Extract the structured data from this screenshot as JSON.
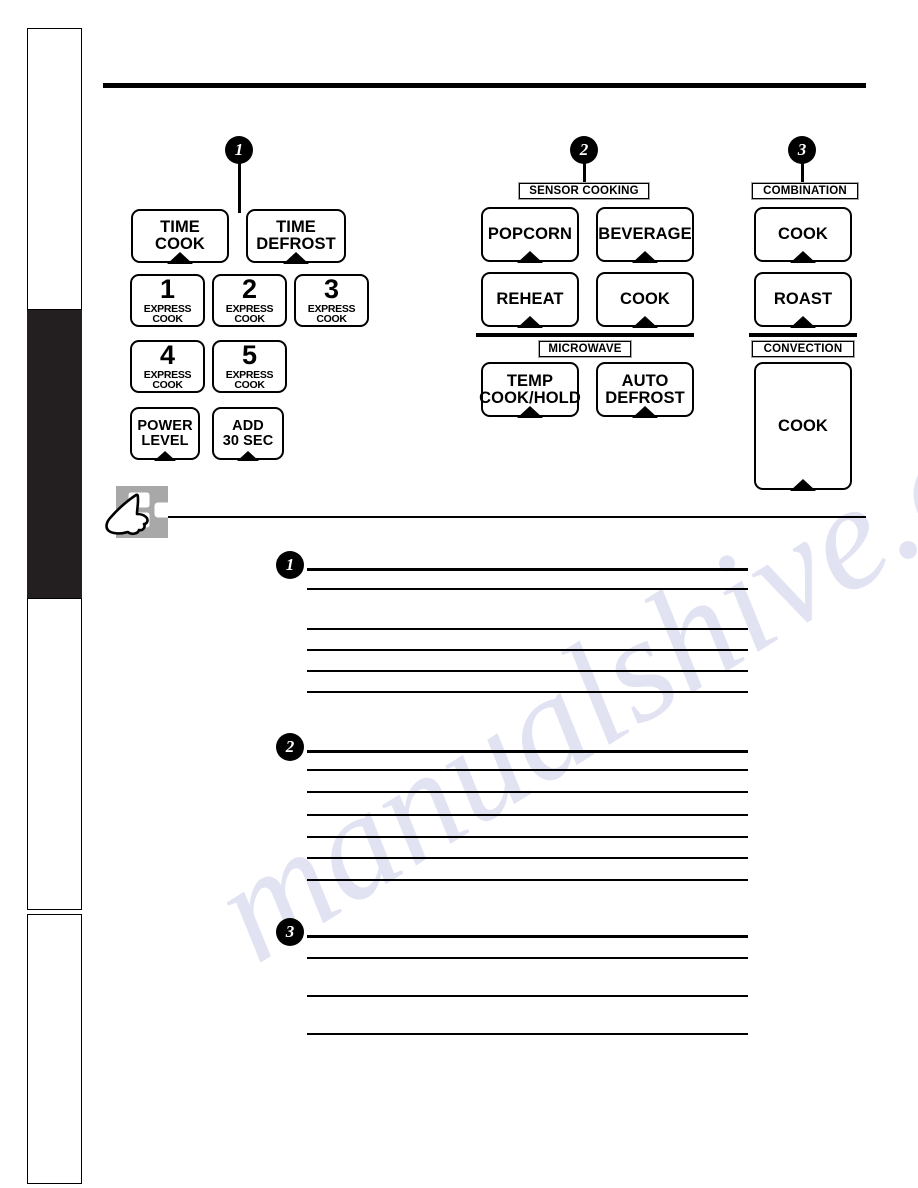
{
  "page": {
    "background": "#ffffff",
    "ink": "#000000",
    "sidebar_active_color": "#231f20",
    "plate_outline_color": "#a6a6a6"
  },
  "sidebar": {
    "tabs": [
      {
        "name": "tab-1",
        "active": false
      },
      {
        "name": "tab-2",
        "active": true
      },
      {
        "name": "tab-3",
        "active": false
      },
      {
        "name": "tab-4",
        "active": false
      }
    ]
  },
  "callouts": [
    {
      "number": "1"
    },
    {
      "number": "2"
    },
    {
      "number": "3"
    }
  ],
  "control_panel": {
    "group1": {
      "callout": "1",
      "keys": [
        {
          "name": "time-cook",
          "lines": [
            "TIME",
            "COOK"
          ],
          "type": "text",
          "notch": true
        },
        {
          "name": "time-defrost",
          "lines": [
            "TIME",
            "DEFROST"
          ],
          "type": "text",
          "notch": true
        },
        {
          "name": "express-cook-1",
          "number": "1",
          "sub": "EXPRESS COOK",
          "type": "express",
          "notch": false
        },
        {
          "name": "express-cook-2",
          "number": "2",
          "sub": "EXPRESS COOK",
          "type": "express",
          "notch": false
        },
        {
          "name": "express-cook-3",
          "number": "3",
          "sub": "EXPRESS COOK",
          "type": "express",
          "notch": false
        },
        {
          "name": "express-cook-4",
          "number": "4",
          "sub": "EXPRESS COOK",
          "type": "express",
          "notch": false
        },
        {
          "name": "express-cook-5",
          "number": "5",
          "sub": "EXPRESS COOK",
          "type": "express",
          "notch": false
        },
        {
          "name": "power-level",
          "lines": [
            "POWER",
            "LEVEL"
          ],
          "type": "text",
          "notch": true
        },
        {
          "name": "add-30-sec",
          "lines": [
            "ADD",
            "30 SEC"
          ],
          "type": "text",
          "notch": true
        }
      ]
    },
    "group2": {
      "callout": "2",
      "caption_sensor": "SENSOR COOKING",
      "caption_microwave": "MICROWAVE",
      "sensor_keys": [
        {
          "name": "popcorn",
          "lines": [
            "POPCORN"
          ],
          "notch": true
        },
        {
          "name": "beverage",
          "lines": [
            "BEVERAGE"
          ],
          "notch": true
        },
        {
          "name": "reheat",
          "lines": [
            "REHEAT"
          ],
          "notch": true
        },
        {
          "name": "sensor-cook",
          "lines": [
            "COOK"
          ],
          "notch": true
        }
      ],
      "microwave_keys": [
        {
          "name": "temp-cook-hold",
          "lines": [
            "TEMP",
            "COOK/HOLD"
          ],
          "notch": true
        },
        {
          "name": "auto-defrost",
          "lines": [
            "AUTO",
            "DEFROST"
          ],
          "notch": true
        }
      ]
    },
    "group3": {
      "callout": "3",
      "caption_combination": "COMBINATION",
      "caption_convection": "CONVECTION",
      "combination_keys": [
        {
          "name": "combination-cook",
          "lines": [
            "COOK"
          ],
          "notch": true
        },
        {
          "name": "combination-roast",
          "lines": [
            "ROAST"
          ],
          "notch": true
        }
      ],
      "convection_keys": [
        {
          "name": "convection-cook",
          "lines": [
            "COOK"
          ],
          "notch": true
        }
      ]
    }
  },
  "notes": {
    "sections": [
      {
        "callout": "1",
        "line_count": 6
      },
      {
        "callout": "2",
        "line_count": 7
      },
      {
        "callout": "3",
        "line_count": 4
      }
    ]
  },
  "watermark": {
    "text": "manualshive.com"
  }
}
